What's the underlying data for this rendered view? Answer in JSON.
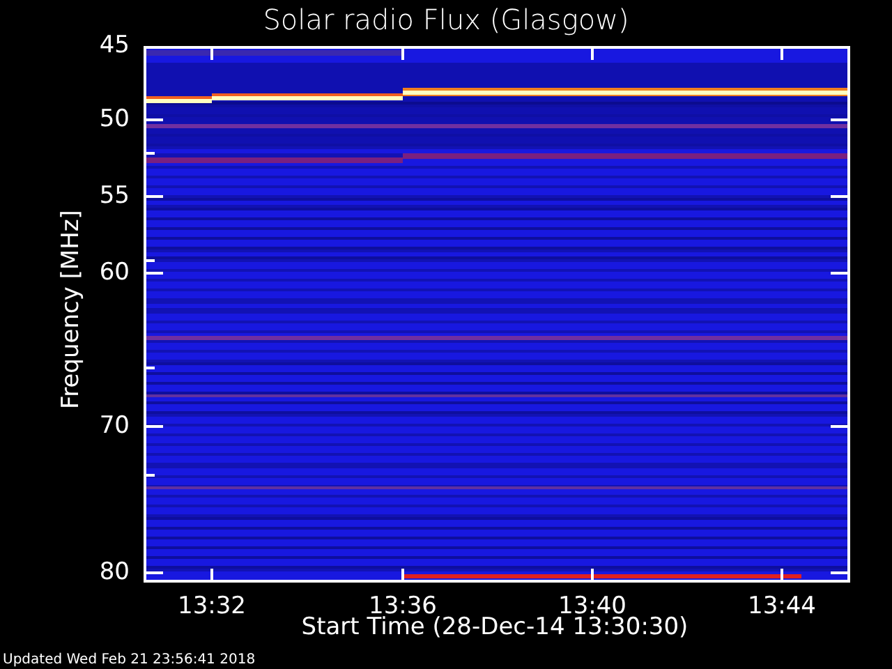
{
  "plot": {
    "title": "Solar radio Flux (Glasgow)",
    "ylabel": "Frequency [MHz]",
    "xlabel": "Start Time (28-Dec-14 13:30:30)",
    "yticks": [
      "45",
      "50",
      "55",
      "60",
      "70",
      "80"
    ],
    "xticks": [
      "13:32",
      "13:36",
      "13:40",
      "13:44"
    ]
  },
  "footer": "Updated Wed Feb 21 23:56:41 2018"
}
